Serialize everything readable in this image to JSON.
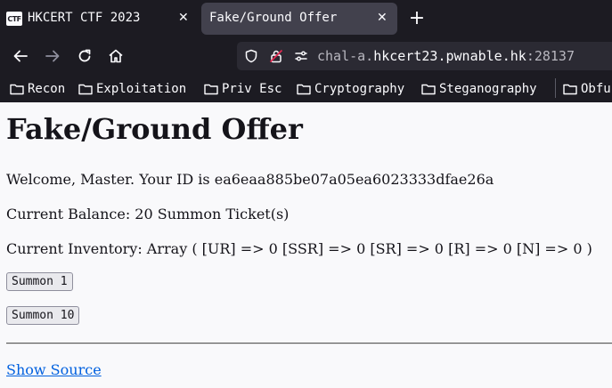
{
  "browser": {
    "tabs": [
      {
        "favicon": "CTF",
        "title": "HKCERT CTF 2023"
      },
      {
        "title": "Fake/Ground Offer"
      }
    ],
    "new_tab_label": "+",
    "close_glyph": "✕",
    "url": {
      "prefix": "chal-a.",
      "domain": "hkcert23.pwnable.hk",
      "port": ":28137"
    },
    "bookmarks": [
      "Recon",
      "Exploitation",
      "Priv Esc",
      "Cryptography",
      "Steganography",
      "Obfu"
    ],
    "icons": [
      "back-arrow-icon",
      "forward-arrow-icon",
      "reload-icon",
      "home-icon",
      "shield-icon",
      "lock-icon",
      "permissions-icon",
      "folder-icon"
    ]
  },
  "page": {
    "title": "Fake/Ground Offer",
    "welcome": "Welcome, Master. Your ID is ea6eaa885be07a05ea6023333dfae26a",
    "balance": "Current Balance: 20 Summon Ticket(s)",
    "inventory": "Current Inventory: Array ( [UR] => 0 [SSR] => 0 [SR] => 0 [R] => 0 [N] => 0 )",
    "summon1_label": "Summon 1",
    "summon10_label": "Summon 10",
    "show_source_label": "Show Source"
  },
  "colors": {
    "chrome_bg": "#1c1b22",
    "active_tab": "#42414d",
    "urlbar_bg": "#2b2a33",
    "page_bg": "#f9f9fb",
    "link": "#0060df"
  }
}
